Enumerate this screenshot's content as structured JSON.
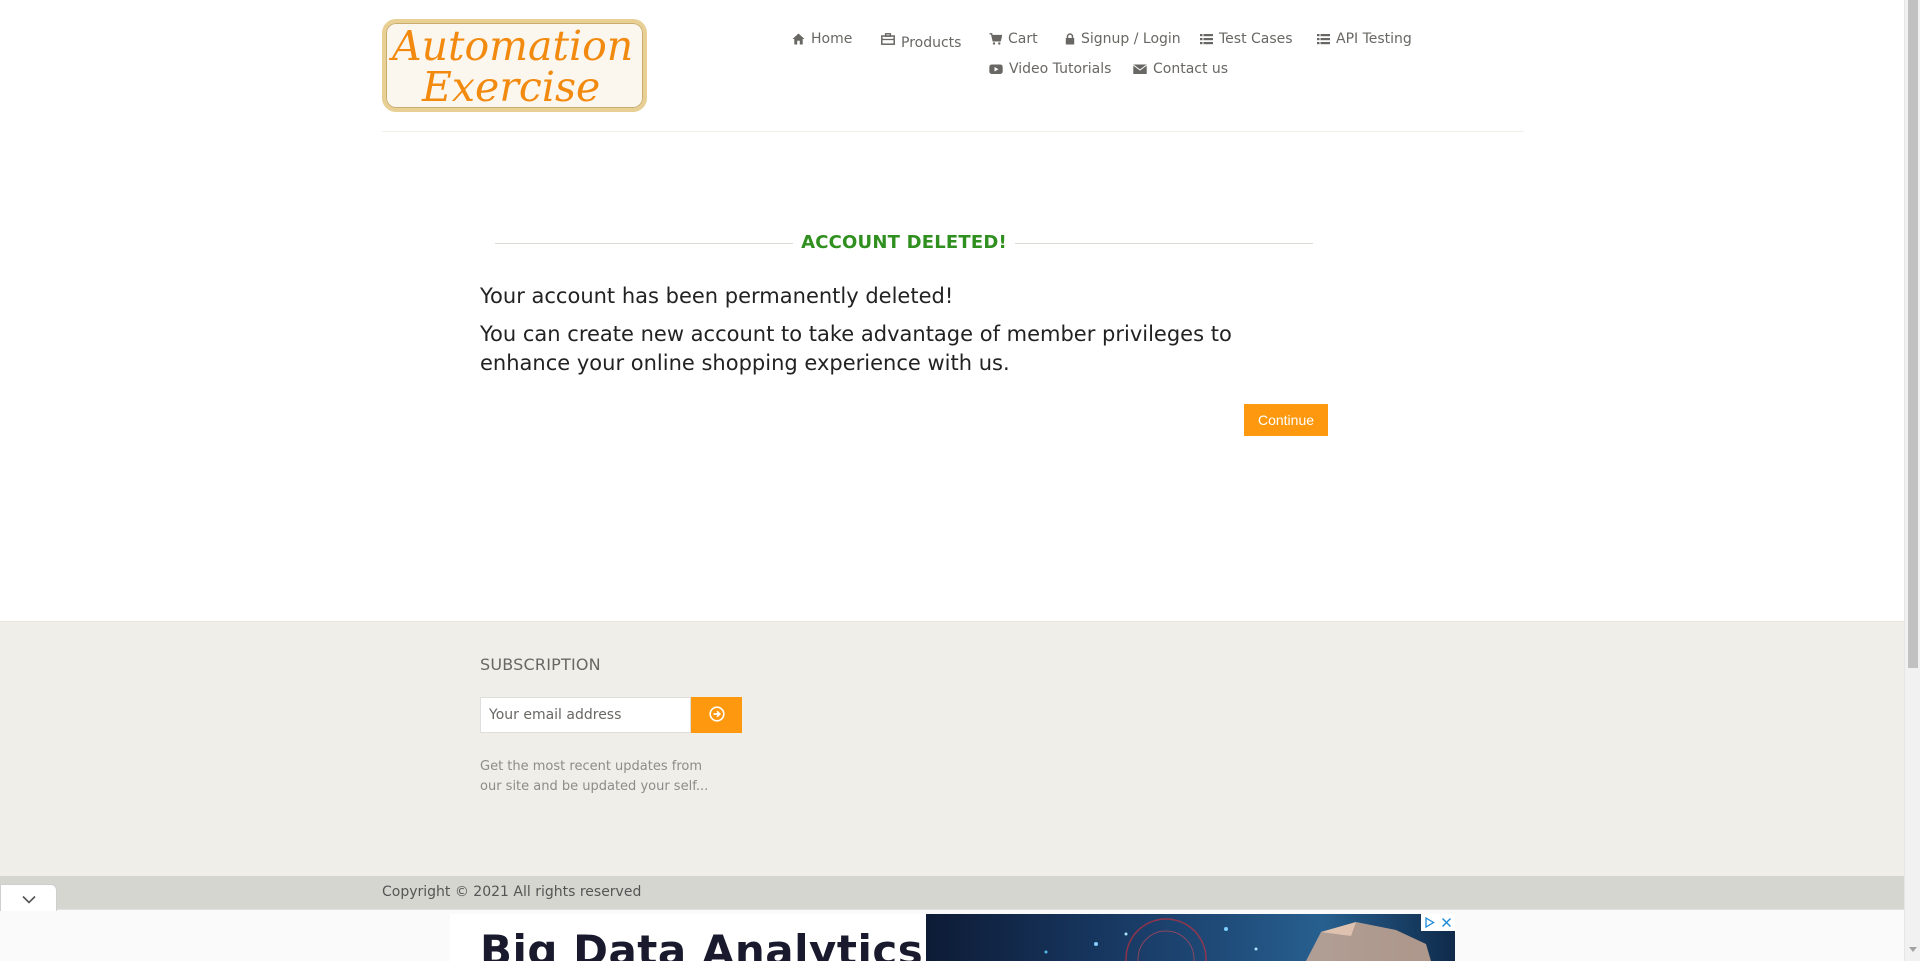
{
  "logo": {
    "line1": "Automation",
    "line2": "Exercise"
  },
  "nav": {
    "home": "Home",
    "products": "Products",
    "cart": "Cart",
    "signup": "Signup / Login",
    "test_cases": "Test Cases",
    "api_testing": "API Testing",
    "video_tutorials": "Video Tutorials",
    "contact_us": "Contact us"
  },
  "main": {
    "title": "ACCOUNT DELETED!",
    "message1": "Your account has been permanently deleted!",
    "message2": "You can create new account to take advantage of member privileges to enhance your online shopping experience with us.",
    "continue_label": "Continue"
  },
  "footer": {
    "subscription_title": "SUBSCRIPTION",
    "email_placeholder": "Your email address",
    "description": "Get the most recent updates from our site and be updated your self...",
    "copyright": "Copyright © 2021 All rights reserved"
  },
  "ad": {
    "headline": "Big Data Analytics"
  },
  "colors": {
    "accent": "#fe980f",
    "success": "#2f8f1f",
    "footer_bg": "#efeee9"
  },
  "icons": [
    "home-icon",
    "products-icon",
    "cart-icon",
    "lock-icon",
    "list-icon",
    "youtube-icon",
    "envelope-icon",
    "arrow-circle-right-icon",
    "chevron-down-icon",
    "ad-info-icon",
    "close-icon"
  ]
}
